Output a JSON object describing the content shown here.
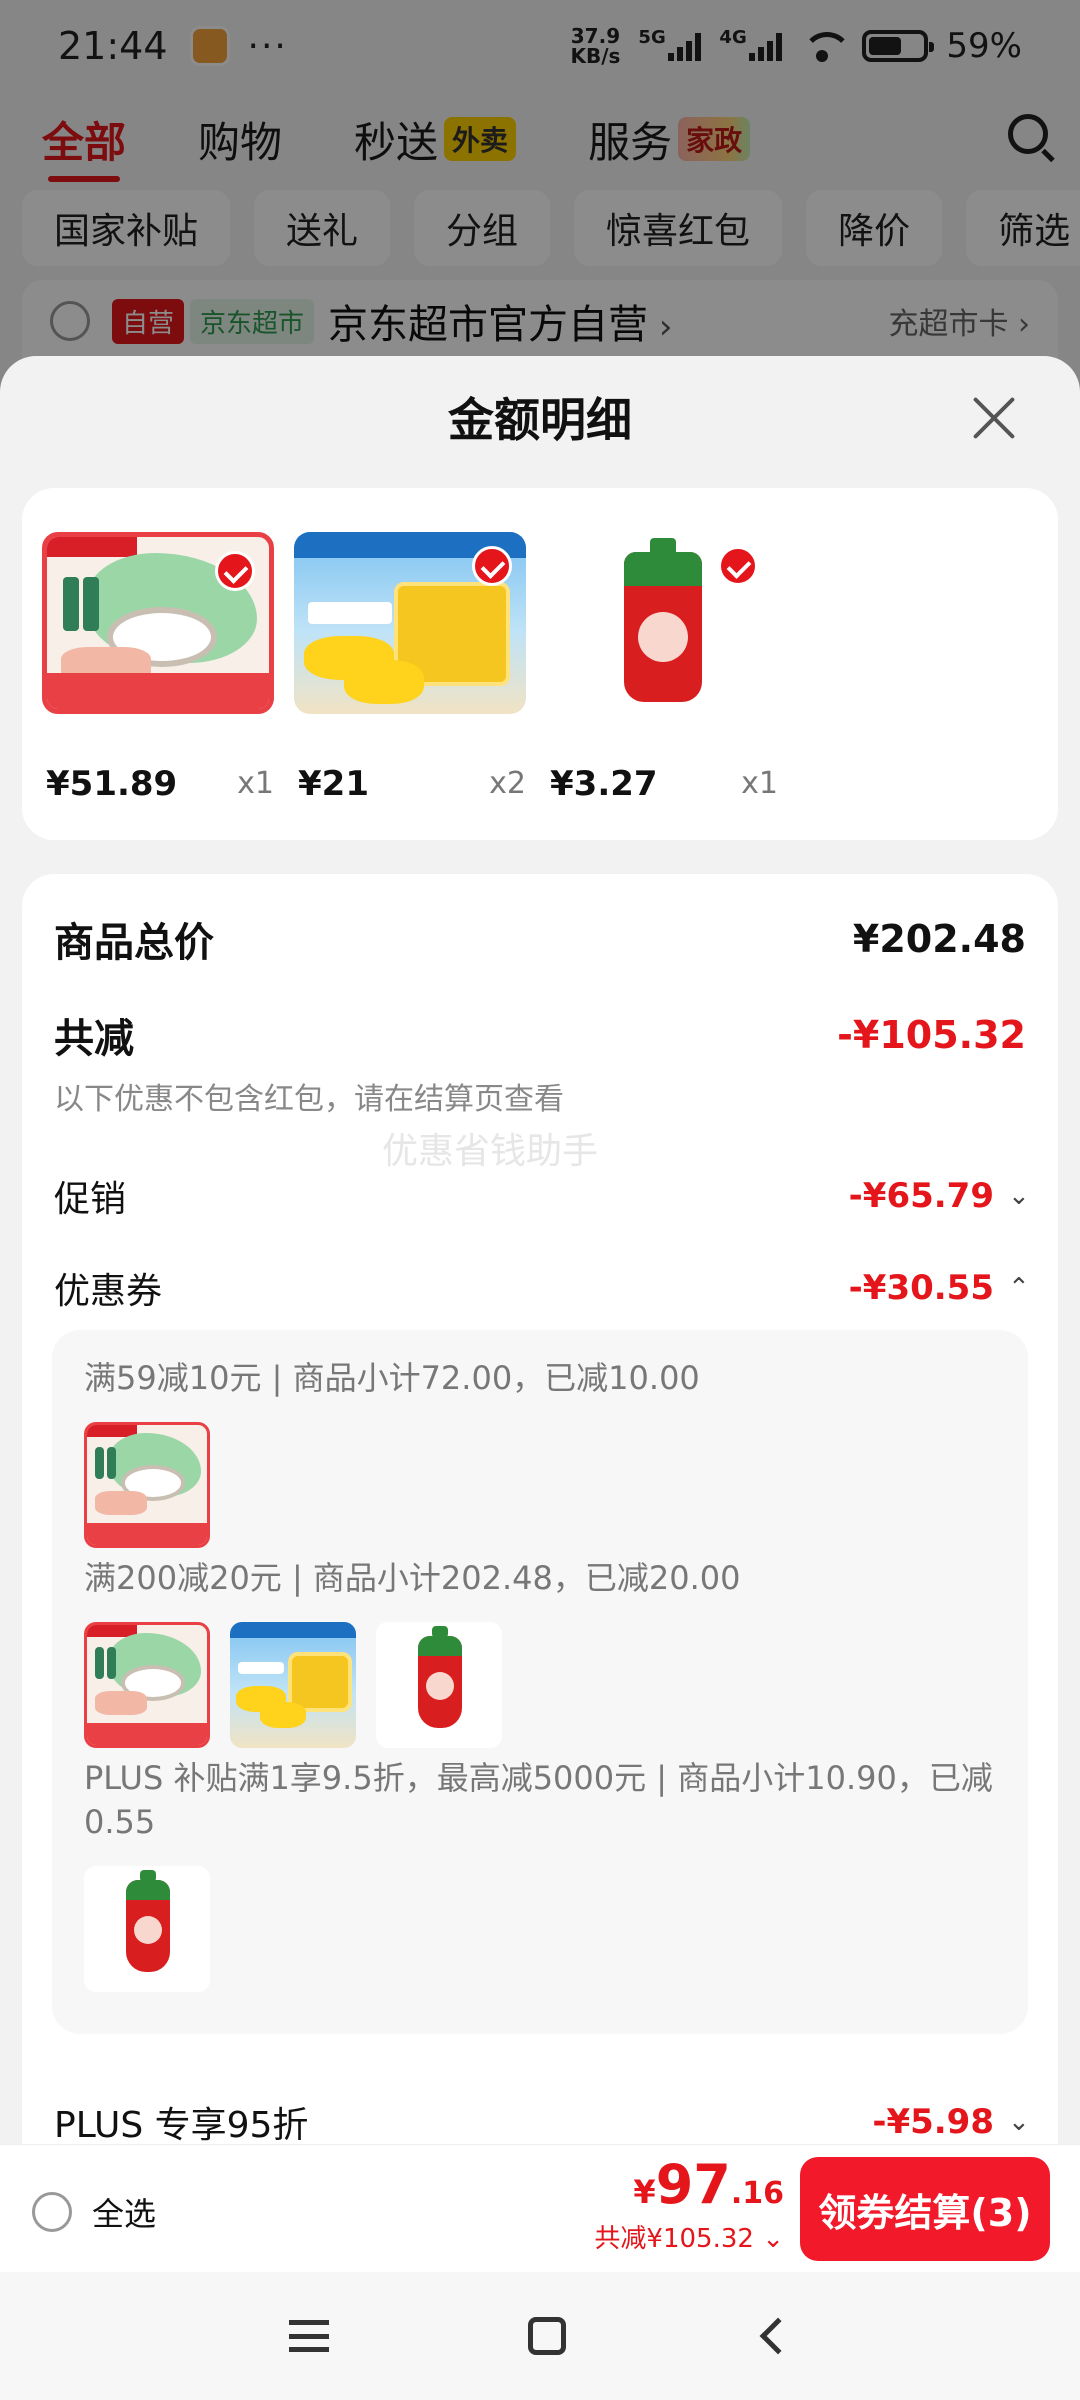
{
  "status_bar": {
    "time": "21:44",
    "dots": "···",
    "net_speed_top": "37.9",
    "net_speed_bottom": "KB/s",
    "signal1": "5G",
    "signal2": "4G",
    "battery": "59%"
  },
  "top_tabs": [
    {
      "label": "全部",
      "badge": ""
    },
    {
      "label": "购物",
      "badge": ""
    },
    {
      "label": "秒送",
      "badge": "外卖"
    },
    {
      "label": "服务",
      "badge": "家政"
    }
  ],
  "filters": [
    "国家补贴",
    "送礼",
    "分组",
    "惊喜红包",
    "降价",
    "筛选"
  ],
  "store": {
    "tag_self": "自营",
    "tag_market": "京东超市",
    "name": "京东超市官方自营",
    "card_link": "充超市卡"
  },
  "sheet": {
    "title": "金额明细",
    "items": [
      {
        "price": "¥51.89",
        "qty": "x1",
        "image": "chicken-product"
      },
      {
        "price": "¥21",
        "qty": "x2",
        "image": "corn-product"
      },
      {
        "price": "¥3.27",
        "qty": "x1",
        "image": "ketchup-product"
      }
    ],
    "total_label": "商品总价",
    "total_value": "¥202.48",
    "reduce_label": "共减",
    "reduce_value": "-¥105.32",
    "reduce_note": "以下优惠不包含红包，请在结算页查看",
    "watermark": "优惠省钱助手",
    "promo_label": "促销",
    "promo_value": "-¥65.79",
    "coupon_label": "优惠券",
    "coupon_value": "-¥30.55",
    "coupon_lines": [
      "满59减10元 | 商品小计72.00，已减10.00",
      "满200减20元 | 商品小计202.48，已减20.00",
      "PLUS 补贴满1享9.5折，最高减5000元 | 商品小计10.90，已减0.55"
    ],
    "plus_label": "PLUS 专享95折",
    "plus_value": "-¥5.98"
  },
  "bottom_bar": {
    "select_all": "全选",
    "currency": "¥",
    "price_int": "97",
    "price_dec": ".16",
    "saved": "共减¥105.32",
    "checkout": "领券结算(3)"
  },
  "colors": {
    "accent": "#e4161b",
    "checkout": "#f2192a"
  }
}
